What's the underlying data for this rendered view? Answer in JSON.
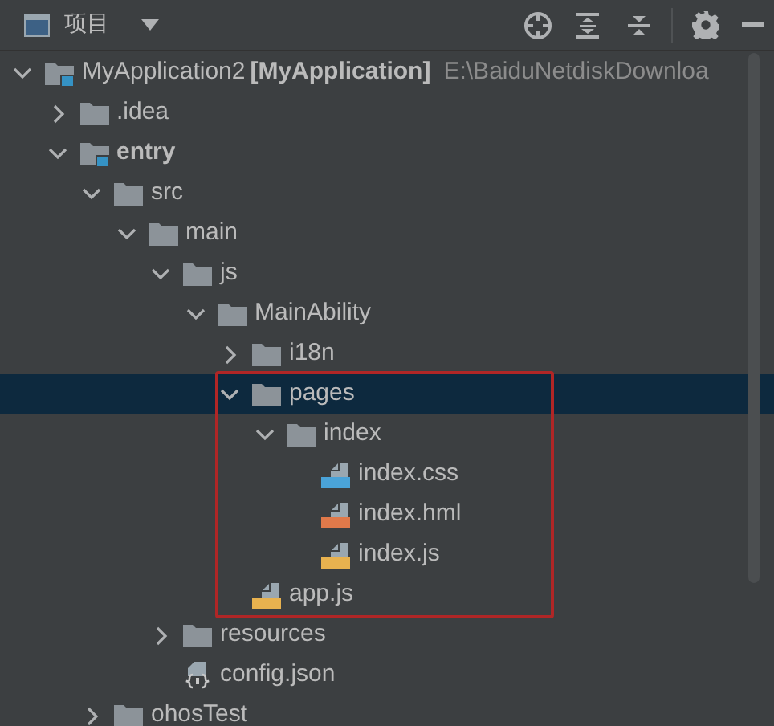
{
  "toolbar": {
    "title": "项目"
  },
  "tree": [
    {
      "kind": "module",
      "label": "MyApplication2",
      "tag": "[MyApplication]",
      "path": "E:\\BaiduNetdiskDownloa",
      "bold": false,
      "expanded": true,
      "selected": false,
      "children": [
        {
          "kind": "folder",
          "label": ".idea",
          "expanded": false,
          "selected": false
        },
        {
          "kind": "module",
          "label": "entry",
          "bold": true,
          "expanded": true,
          "selected": false,
          "children": [
            {
              "kind": "folder",
              "label": "src",
              "expanded": true,
              "selected": false,
              "children": [
                {
                  "kind": "folder",
                  "label": "main",
                  "expanded": true,
                  "selected": false,
                  "children": [
                    {
                      "kind": "folder",
                      "label": "js",
                      "expanded": true,
                      "selected": false,
                      "children": [
                        {
                          "kind": "folder",
                          "label": "MainAbility",
                          "expanded": true,
                          "selected": false,
                          "children": [
                            {
                              "kind": "folder",
                              "label": "i18n",
                              "expanded": false,
                              "selected": false
                            },
                            {
                              "kind": "folder",
                              "label": "pages",
                              "expanded": true,
                              "selected": true,
                              "children": [
                                {
                                  "kind": "folder",
                                  "label": "index",
                                  "expanded": true,
                                  "selected": false,
                                  "children": [
                                    {
                                      "kind": "css",
                                      "label": "index.css",
                                      "selected": false
                                    },
                                    {
                                      "kind": "html",
                                      "label": "index.hml",
                                      "selected": false
                                    },
                                    {
                                      "kind": "js",
                                      "label": "index.js",
                                      "selected": false
                                    }
                                  ]
                                }
                              ]
                            },
                            {
                              "kind": "js",
                              "label": "app.js",
                              "selected": false
                            }
                          ]
                        }
                      ]
                    },
                    {
                      "kind": "folder",
                      "label": "resources",
                      "expanded": false,
                      "selected": false
                    },
                    {
                      "kind": "json",
                      "label": "config.json",
                      "selected": false
                    }
                  ]
                }
              ]
            },
            {
              "kind": "folder",
              "label": "ohosTest",
              "expanded": false,
              "selected": false
            }
          ]
        }
      ]
    }
  ]
}
